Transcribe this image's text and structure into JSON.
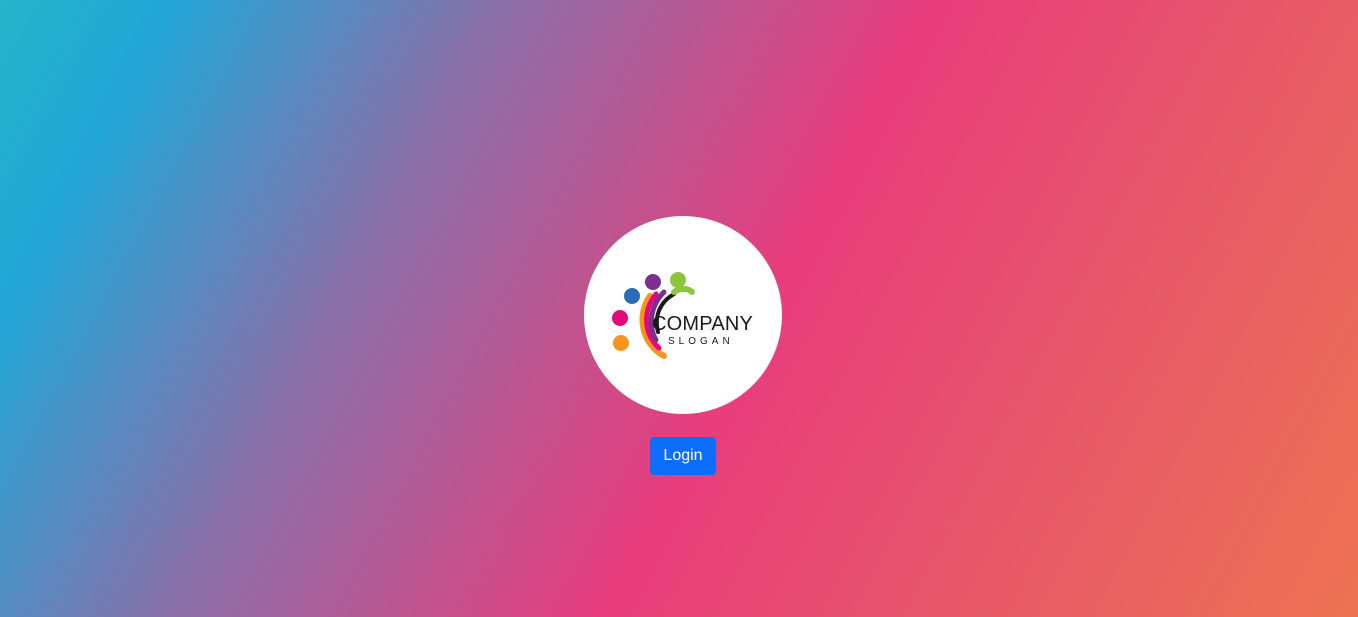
{
  "logo": {
    "alt": "Company logo",
    "company_text": "COMPANY",
    "slogan_text": "SLOGAN",
    "colors": {
      "blue": "#2a6db5",
      "purple": "#7b2f8f",
      "green": "#8cc63f",
      "magenta": "#e4097b",
      "orange": "#f7941d",
      "dark": "#1a1a1a"
    }
  },
  "login": {
    "label": "Login",
    "color": "#0d6efd"
  },
  "background": {
    "gradient_colors": [
      "#23b5c9",
      "#21a6d7",
      "#8c6fa8",
      "#e83d7c",
      "#e8566a",
      "#ec7352"
    ]
  }
}
